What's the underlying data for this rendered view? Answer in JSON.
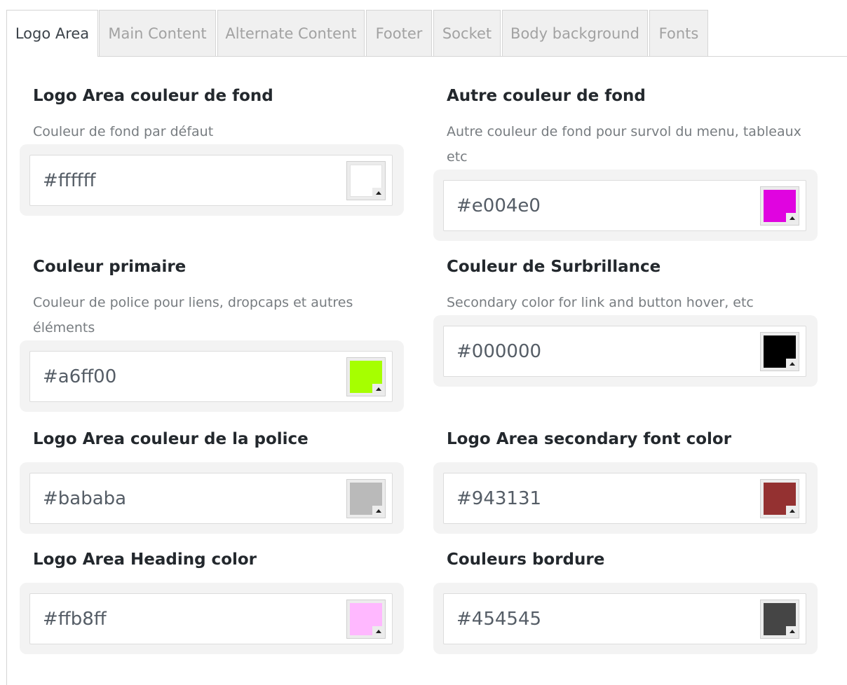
{
  "tabs": [
    {
      "label": "Logo Area",
      "active": true
    },
    {
      "label": "Main Content",
      "active": false
    },
    {
      "label": "Alternate Content",
      "active": false
    },
    {
      "label": "Footer",
      "active": false
    },
    {
      "label": "Socket",
      "active": false
    },
    {
      "label": "Body background",
      "active": false
    },
    {
      "label": "Fonts",
      "active": false
    }
  ],
  "fields": [
    {
      "title": "Logo Area couleur de fond",
      "desc": "Couleur de fond par défaut",
      "value": "#ffffff",
      "swatch": "#ffffff"
    },
    {
      "title": "Autre couleur de fond",
      "desc": "Autre couleur de fond pour survol du menu, tableaux etc",
      "value": "#e004e0",
      "swatch": "#e004e0"
    },
    {
      "title": "Couleur primaire",
      "desc": "Couleur de police pour liens, dropcaps et autres éléments",
      "value": "#a6ff00",
      "swatch": "#a6ff00"
    },
    {
      "title": "Couleur de Surbrillance",
      "desc": "Secondary color for link and button hover, etc",
      "value": "#000000",
      "swatch": "#000000"
    },
    {
      "title": "Logo Area couleur de la police",
      "desc": "",
      "value": "#bababa",
      "swatch": "#bababa"
    },
    {
      "title": "Logo Area secondary font color",
      "desc": "",
      "value": "#943131",
      "swatch": "#943131"
    },
    {
      "title": "Logo Area Heading color",
      "desc": "",
      "value": "#ffb8ff",
      "swatch": "#ffb8ff"
    },
    {
      "title": "Couleurs bordure",
      "desc": "",
      "value": "#454545",
      "swatch": "#454545"
    }
  ]
}
